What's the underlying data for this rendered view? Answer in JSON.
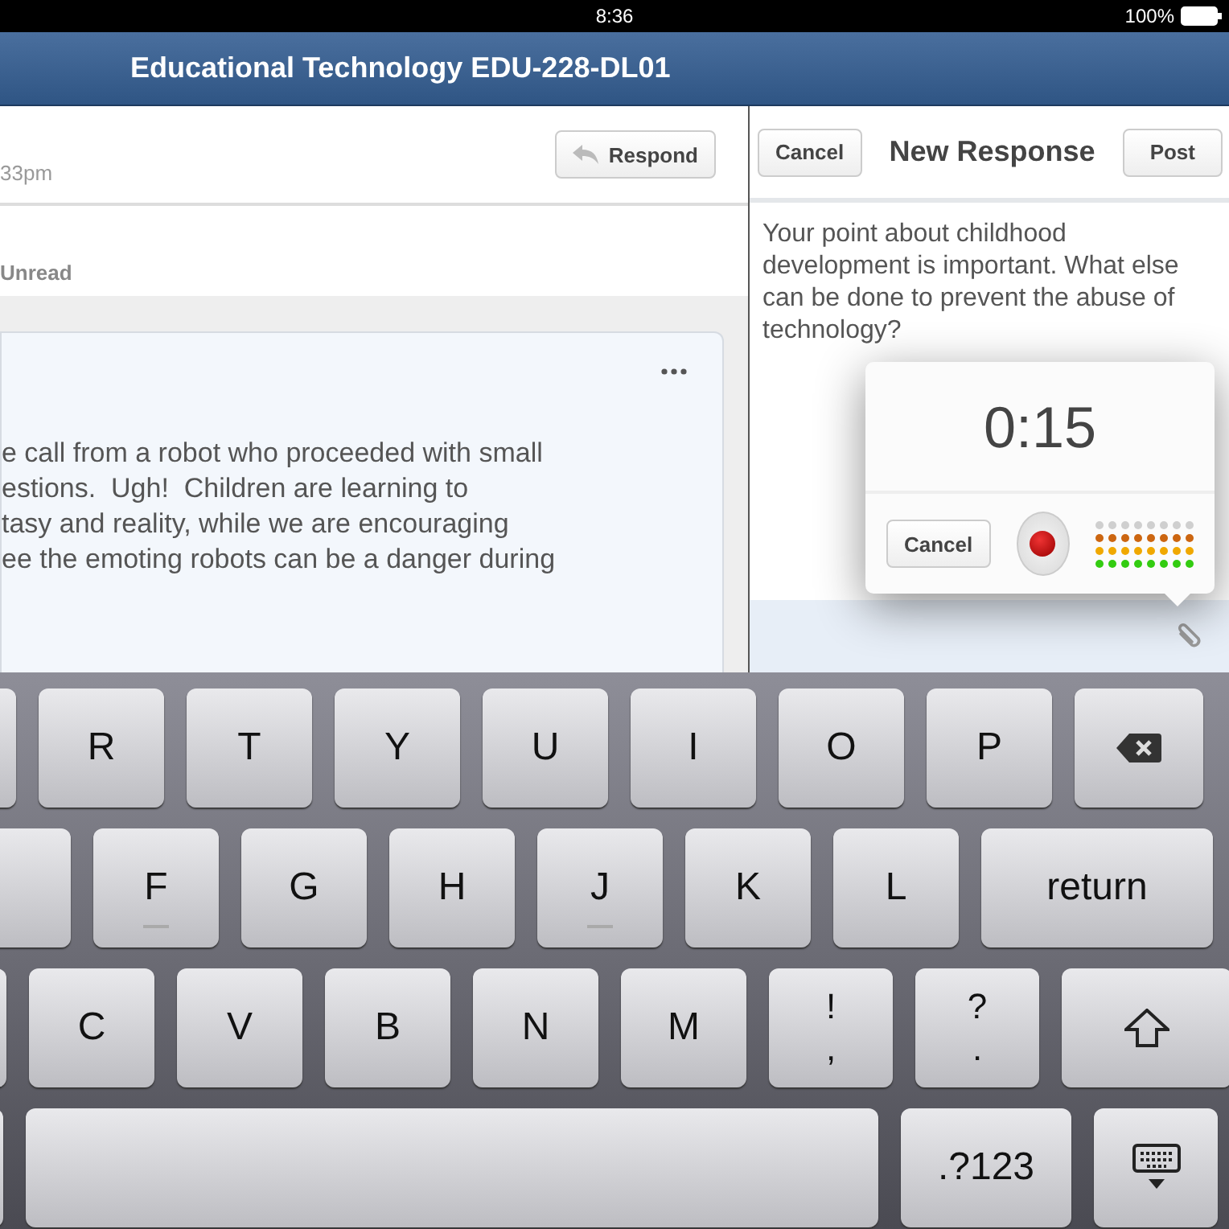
{
  "status_bar": {
    "time": "8:36",
    "battery": "100%"
  },
  "nav_bar": {
    "title": "Educational Technology EDU-228-DL01"
  },
  "thread": {
    "time": "33pm",
    "respond_button": "Respond",
    "filter": "Unread",
    "post": {
      "body": "e call from a robot who proceeded with small\nestions.  Ugh!  Children are learning to\ntasy and reality, while we are encouraging\nee the emoting robots can be a danger during"
    }
  },
  "composer": {
    "cancel_button": "Cancel",
    "title": "New Response",
    "post_button": "Post",
    "text": "Your point about childhood development is important. What else can be done to prevent the abuse of technology?"
  },
  "recorder": {
    "time": "0:15",
    "cancel_button": "Cancel",
    "recording": true,
    "level": 0.75
  },
  "keyboard": {
    "rows": [
      {
        "keys": [
          {
            "kind": "sliver"
          },
          {
            "kind": "letter",
            "label": "R"
          },
          {
            "kind": "letter",
            "label": "T"
          },
          {
            "kind": "letter",
            "label": "Y"
          },
          {
            "kind": "letter",
            "label": "U"
          },
          {
            "kind": "letter",
            "label": "I"
          },
          {
            "kind": "letter",
            "label": "O"
          },
          {
            "kind": "letter",
            "label": "P"
          },
          {
            "kind": "delete"
          }
        ]
      },
      {
        "keys": [
          {
            "kind": "sliver"
          },
          {
            "kind": "letter",
            "label": "F",
            "home": true
          },
          {
            "kind": "letter",
            "label": "G"
          },
          {
            "kind": "letter",
            "label": "H"
          },
          {
            "kind": "letter",
            "label": "J",
            "home": true
          },
          {
            "kind": "letter",
            "label": "K"
          },
          {
            "kind": "letter",
            "label": "L"
          },
          {
            "kind": "wide",
            "label": "return"
          }
        ]
      },
      {
        "keys": [
          {
            "kind": "sliver"
          },
          {
            "kind": "letter",
            "label": "C"
          },
          {
            "kind": "letter",
            "label": "V"
          },
          {
            "kind": "letter",
            "label": "B"
          },
          {
            "kind": "letter",
            "label": "N"
          },
          {
            "kind": "letter",
            "label": "M"
          },
          {
            "kind": "pair",
            "label": "!",
            "sub": ","
          },
          {
            "kind": "pair",
            "label": "?",
            "sub": "."
          },
          {
            "kind": "shift"
          }
        ]
      },
      {
        "keys": [
          {
            "kind": "sliver"
          },
          {
            "kind": "space"
          },
          {
            "kind": "symbol",
            "label": ".?123"
          },
          {
            "kind": "hide"
          }
        ]
      }
    ]
  }
}
